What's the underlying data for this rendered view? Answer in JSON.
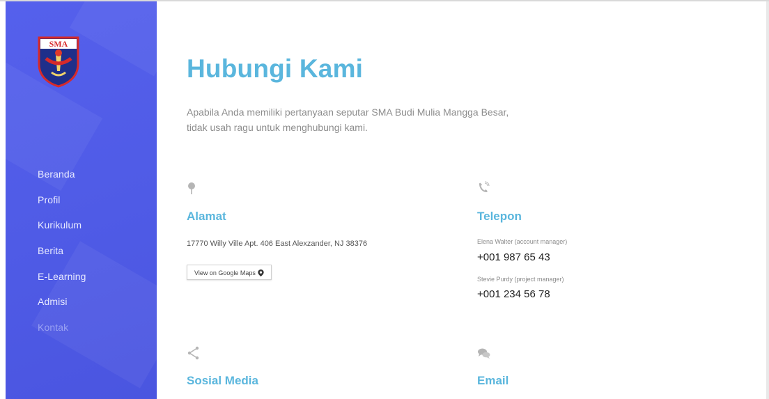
{
  "sidebar": {
    "logo_text": "SMA",
    "nav_items": [
      {
        "label": "Beranda"
      },
      {
        "label": "Profil"
      },
      {
        "label": "Kurikulum"
      },
      {
        "label": "Berita"
      },
      {
        "label": "E-Learning"
      },
      {
        "label": "Admisi"
      },
      {
        "label": "Kontak"
      }
    ]
  },
  "main": {
    "title": "Hubungi Kami",
    "intro_line1": "Apabila Anda memiliki pertanyaan seputar SMA Budi Mulia Mangga Besar,",
    "intro_line2": "tidak usah ragu untuk menghubungi kami.",
    "alamat": {
      "icon": "map-pin-icon",
      "heading": "Alamat",
      "address": "17770 Willy Ville Apt. 406 East Alexzander, NJ 38376",
      "maps_button": "View on Google Maps"
    },
    "telepon": {
      "icon": "phone-icon",
      "heading": "Telepon",
      "contacts": [
        {
          "name": "Elena Walter (account manager)",
          "phone": "+001 987 65 43"
        },
        {
          "name": "Stevie Purdy (project manager)",
          "phone": "+001 234 56 78"
        }
      ]
    },
    "sosial": {
      "icon": "share-icon",
      "heading": "Sosial Media"
    },
    "email": {
      "icon": "chat-bubbles-icon",
      "heading": "Email"
    }
  },
  "colors": {
    "sidebar": "#5560ec",
    "accent": "#5ab6dd",
    "muted_text": "#8d8d8d"
  }
}
